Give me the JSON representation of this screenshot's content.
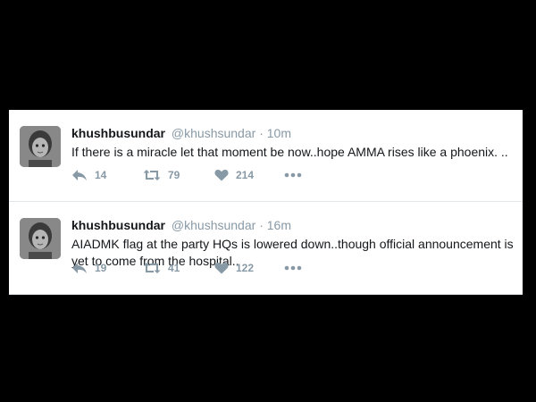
{
  "tweets": [
    {
      "name": "khushbusundar",
      "handle": "@khushsundar",
      "separator": "·",
      "time": "10m",
      "text": "If there is a miracle let that moment be now..hope AMMA rises like a phoenix. ..",
      "replies": "14",
      "retweets": "79",
      "likes": "214"
    },
    {
      "name": "khushbusundar",
      "handle": "@khushsundar",
      "separator": "·",
      "time": "16m",
      "text": "AIADMK flag at the party HQs is lowered down..though official announcement is yet to come from the hospital..",
      "replies": "19",
      "retweets": "41",
      "likes": "122"
    }
  ],
  "icons": {
    "reply": "reply-icon",
    "retweet": "retweet-icon",
    "like": "heart-icon",
    "more": "more-options-icon",
    "avatar": "profile-avatar"
  },
  "colors": {
    "background": "#000000",
    "panel": "#ffffff",
    "text": "#14171a",
    "muted": "#8899a6",
    "divider": "#e1e8ed"
  }
}
